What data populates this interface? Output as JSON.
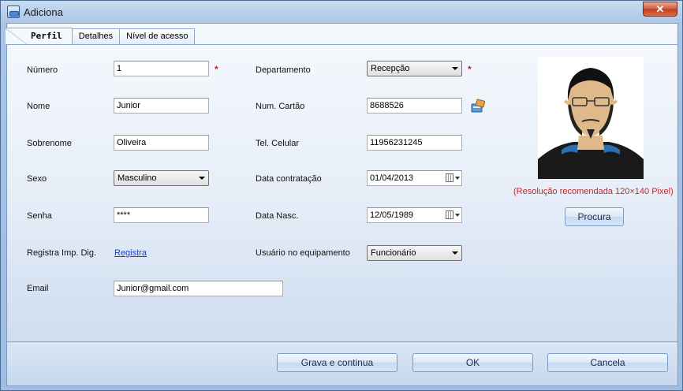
{
  "window": {
    "title": "Adiciona",
    "close_label": "✕"
  },
  "tabs": [
    {
      "label": "Perfil"
    },
    {
      "label": "Detalhes"
    },
    {
      "label": "Nível de acesso"
    }
  ],
  "form": {
    "numero": {
      "label": "Número",
      "value": "1"
    },
    "nome": {
      "label": "Nome",
      "value": "Junior"
    },
    "sobrenome": {
      "label": "Sobrenome",
      "value": "Oliveira"
    },
    "sexo": {
      "label": "Sexo",
      "value": "Masculino"
    },
    "senha": {
      "label": "Senha",
      "value": "****"
    },
    "registra": {
      "label": "Registra Imp. Dig.",
      "link": "Registra"
    },
    "email": {
      "label": "Email",
      "value": "Junior@gmail.com"
    },
    "departamento": {
      "label": "Departamento",
      "value": "Recepção"
    },
    "cartao": {
      "label": "Num. Cartão",
      "value": "8688526"
    },
    "celular": {
      "label": "Tel. Celular",
      "value": "11956231245"
    },
    "contratacao": {
      "label": "Data contratação",
      "value": "01/04/2013"
    },
    "nasc": {
      "label": "Data Nasc.",
      "value": "12/05/1989"
    },
    "usuario": {
      "label": "Usuário no equipamento",
      "value": "Funcionário"
    },
    "required_mark": "*"
  },
  "photo": {
    "note": "(Resolução recomendada 120×140 Pixel)",
    "browse_label": "Procura"
  },
  "footer": {
    "save_continue": "Grava e continua",
    "ok": "OK",
    "cancel": "Cancela"
  },
  "icons": {
    "app": "window-app-icon",
    "card": "card-reader-icon",
    "calendar": "calendar-icon"
  }
}
